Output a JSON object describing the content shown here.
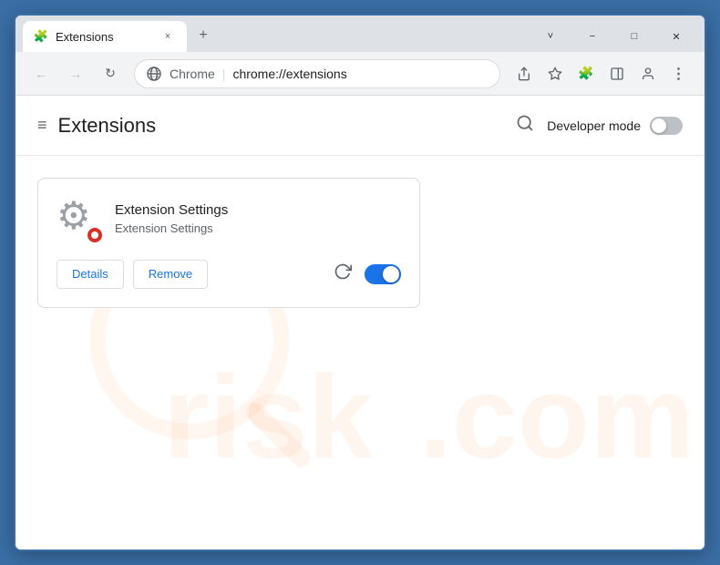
{
  "window": {
    "title": "Extensions",
    "controls": {
      "minimize": "−",
      "maximize": "□",
      "close": "✕",
      "hide": "˅"
    }
  },
  "tab": {
    "favicon": "🧩",
    "label": "Extensions",
    "close": "×",
    "new_tab": "+"
  },
  "toolbar": {
    "back": "←",
    "forward": "→",
    "reload": "↻",
    "browser_name": "Chrome",
    "separator": "|",
    "url": "chrome://extensions",
    "share_icon": "⬆",
    "bookmark_icon": "☆",
    "extensions_icon": "🧩",
    "split_icon": "⊡",
    "profile_icon": "👤",
    "menu_icon": "⋮"
  },
  "page": {
    "menu_icon": "≡",
    "title": "Extensions",
    "search_label": "search",
    "dev_mode_label": "Developer mode",
    "dev_mode_on": false
  },
  "extension": {
    "name": "Extension Settings",
    "description": "Extension Settings",
    "details_btn": "Details",
    "remove_btn": "Remove",
    "enabled": true
  },
  "watermark": {
    "text": "risk.com"
  }
}
